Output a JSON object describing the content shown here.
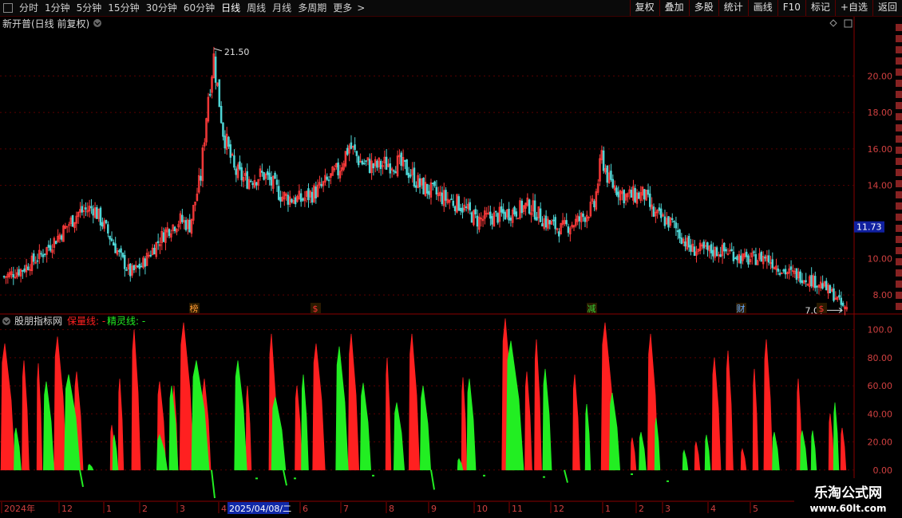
{
  "toolbar": {
    "window_icon": "window-icon",
    "periods": [
      "分时",
      "1分钟",
      "5分钟",
      "15分钟",
      "30分钟",
      "60分钟",
      "日线",
      "周线",
      "月线",
      "多周期",
      "更多"
    ],
    "active_period": "日线",
    "more_arrow": ">",
    "right_buttons": [
      "复权",
      "叠加",
      "多股",
      "统计",
      "画线",
      "F10",
      "标记",
      "+自选",
      "返回"
    ]
  },
  "main_chart": {
    "title": "新开普(日线 前复权)",
    "high_label": "21.50",
    "low_label": "7.07",
    "current_price": "11.73",
    "price_axis": [
      "20.00",
      "18.00",
      "16.00",
      "14.00",
      "10.00",
      "8.00"
    ],
    "price_ticks": [
      20,
      18,
      16,
      14,
      10,
      8
    ],
    "markers": [
      {
        "label": "榜",
        "color": "#ff9933"
      },
      {
        "label": "$",
        "color": "#ff3333"
      },
      {
        "label": "减",
        "color": "#33cc33"
      },
      {
        "label": "财",
        "color": "#66aaff"
      },
      {
        "label": "$",
        "color": "#ff3333"
      }
    ]
  },
  "indicator": {
    "name": "股朋指标网",
    "line1_label": "保量线: -",
    "line2_label": "精灵线: -",
    "line1_color": "#ff2020",
    "line2_color": "#22ee22",
    "axis": [
      "100.0",
      "80.00",
      "60.00",
      "40.00",
      "20.00",
      "0.00"
    ],
    "axis_ticks": [
      100,
      80,
      60,
      40,
      20,
      0
    ]
  },
  "date_axis": {
    "labels": [
      "2024年",
      "12",
      "1",
      "2",
      "3",
      "4",
      "2025/04/08/二",
      "6",
      "7",
      "8",
      "9",
      "10",
      "11",
      "12",
      "1",
      "2",
      "3",
      "4",
      "5"
    ]
  },
  "watermark": {
    "title": "乐淘公式网",
    "url": "www.60lt.com"
  },
  "colors": {
    "up": "#ff3b3b",
    "down": "#4fd5d5",
    "grid": "#5a0000",
    "axis_text": "#d04040"
  },
  "chart_data": {
    "type": "candlestick",
    "title": "新开普(日线 前复权)",
    "price_range": [
      7.0,
      22.5
    ],
    "high": 21.5,
    "low": 7.07,
    "current": 11.73,
    "close_keypoints": [
      [
        0,
        9.0
      ],
      [
        10,
        9.4
      ],
      [
        20,
        10.2
      ],
      [
        30,
        11.3
      ],
      [
        40,
        12.5
      ],
      [
        48,
        12.8
      ],
      [
        55,
        11.6
      ],
      [
        62,
        10.2
      ],
      [
        68,
        9.2
      ],
      [
        74,
        9.6
      ],
      [
        80,
        10.5
      ],
      [
        88,
        11.6
      ],
      [
        95,
        12.1
      ],
      [
        100,
        11.8
      ],
      [
        106,
        14.5
      ],
      [
        110,
        19.0
      ],
      [
        113,
        21.0
      ],
      [
        118,
        17.0
      ],
      [
        124,
        14.8
      ],
      [
        130,
        14.3
      ],
      [
        140,
        14.6
      ],
      [
        150,
        13.4
      ],
      [
        160,
        13.2
      ],
      [
        170,
        13.8
      ],
      [
        180,
        14.8
      ],
      [
        186,
        16.2
      ],
      [
        192,
        15.3
      ],
      [
        200,
        15.0
      ],
      [
        210,
        15.3
      ],
      [
        218,
        14.8
      ],
      [
        224,
        14.0
      ],
      [
        235,
        13.4
      ],
      [
        245,
        13.0
      ],
      [
        255,
        12.1
      ],
      [
        265,
        12.3
      ],
      [
        275,
        12.6
      ],
      [
        283,
        12.9
      ],
      [
        292,
        12.0
      ],
      [
        300,
        11.6
      ],
      [
        310,
        12.1
      ],
      [
        318,
        12.9
      ],
      [
        322,
        15.6
      ],
      [
        326,
        14.2
      ],
      [
        335,
        13.4
      ],
      [
        345,
        13.5
      ],
      [
        350,
        12.4
      ],
      [
        360,
        11.9
      ],
      [
        370,
        10.5
      ],
      [
        380,
        10.4
      ],
      [
        390,
        10.4
      ],
      [
        400,
        9.9
      ],
      [
        410,
        10.1
      ],
      [
        420,
        9.3
      ],
      [
        430,
        9.0
      ],
      [
        440,
        8.6
      ],
      [
        448,
        7.9
      ],
      [
        452,
        7.3
      ]
    ],
    "indicator_range": [
      -20,
      110
    ],
    "indicator_series": [
      {
        "name": "保量线",
        "color": "#ff2020"
      },
      {
        "name": "精灵线",
        "color": "#22ee22"
      }
    ]
  }
}
